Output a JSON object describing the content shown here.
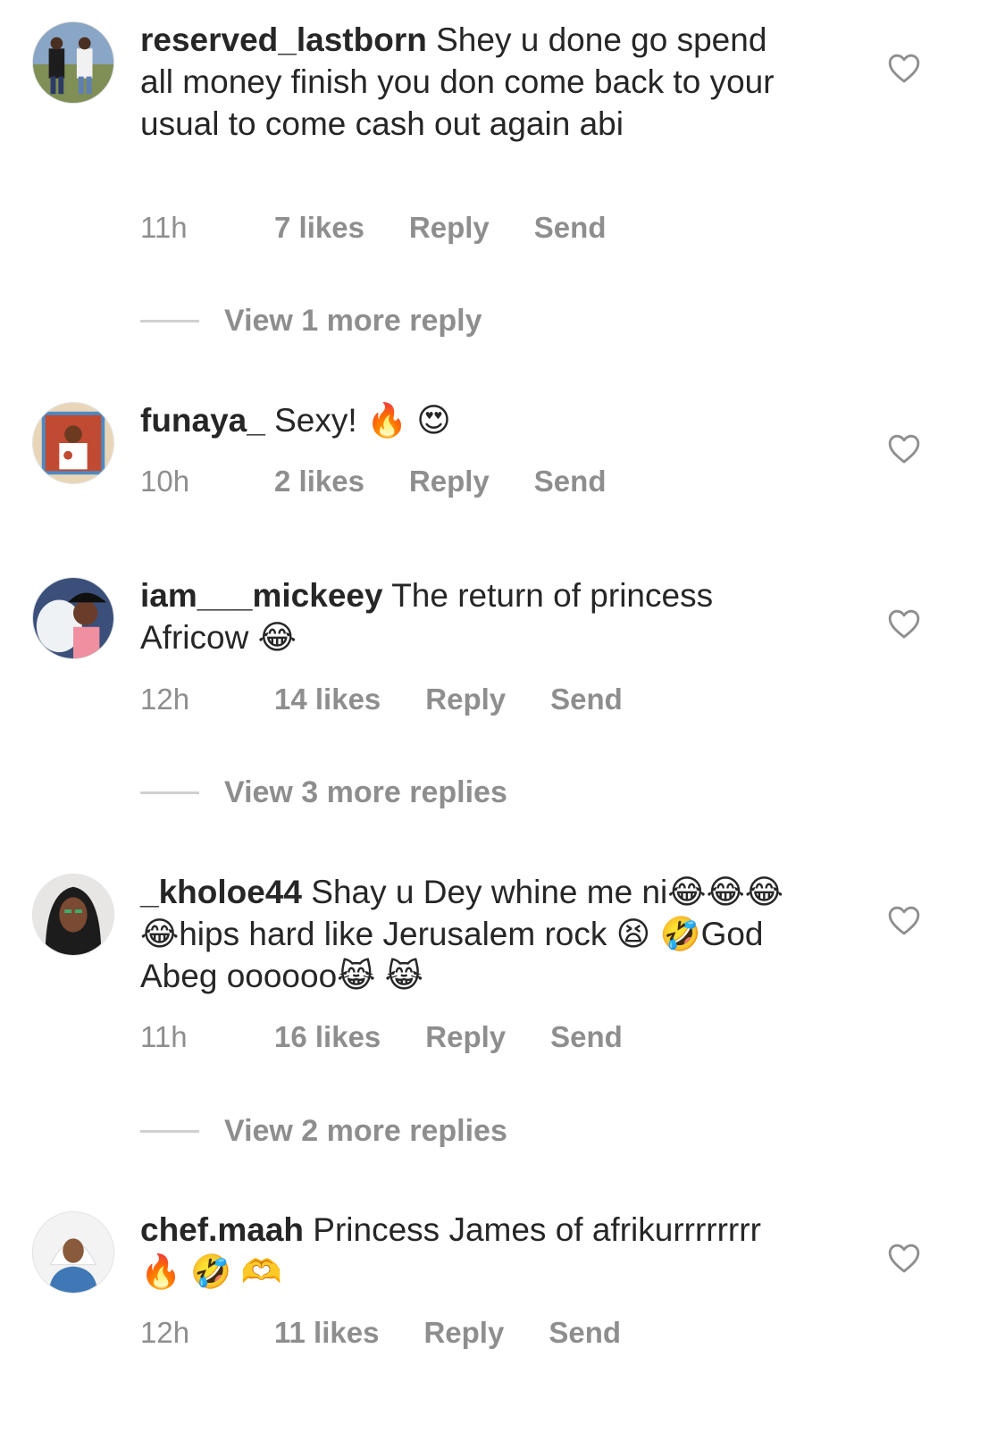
{
  "comments": [
    {
      "username": "reserved_lastborn",
      "text": "Shey u done go spend all money finish you don come back to your usual to come cash out again abi",
      "time": "11h",
      "likes": "7 likes",
      "reply": "Reply",
      "send": "Send"
    },
    {
      "username": "funaya_",
      "text": "Sexy! 🔥 😍",
      "time": "10h",
      "likes": "2 likes",
      "reply": "Reply",
      "send": "Send"
    },
    {
      "username": "iam___mickeey",
      "text": "The return of princess Africow 😂",
      "time": "12h",
      "likes": "14 likes",
      "reply": "Reply",
      "send": "Send"
    },
    {
      "username": "_kholoe44",
      "text": "Shay u Dey whine me ni😂😂😂😂hips hard like Jerusalem rock 😫 🤣God Abeg oooooo😹 😹",
      "time": "11h",
      "likes": "16 likes",
      "reply": "Reply",
      "send": "Send"
    },
    {
      "username": "chef.maah",
      "text": "Princess James of afrikurrrrrrrr🔥 🤣 🫶",
      "time": "12h",
      "likes": "11 likes",
      "reply": "Reply",
      "send": "Send"
    }
  ],
  "view_more": [
    "View 1 more reply",
    "View 3 more replies",
    "View 2 more replies"
  ],
  "icons": {
    "like": "heart-outline-icon"
  },
  "colors": {
    "text": "#262626",
    "secondary": "#8e8e8e",
    "divider": "#d0d0d0"
  }
}
